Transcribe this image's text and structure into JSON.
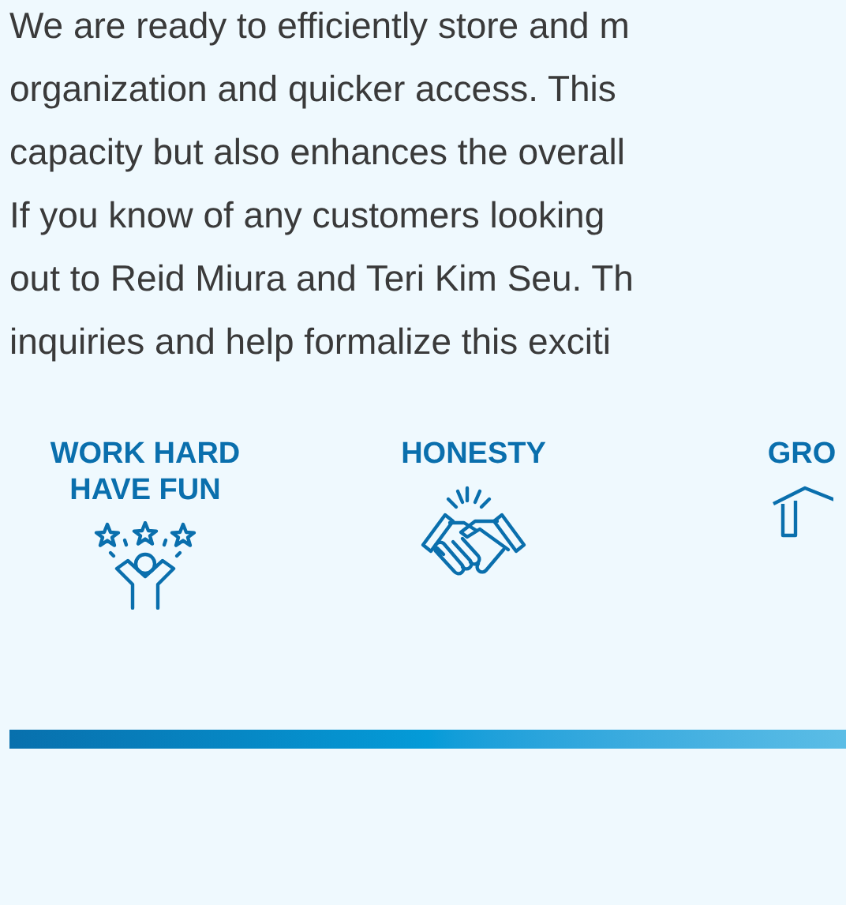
{
  "paragraph_lines": [
    "We are ready to efficiently store and m",
    "organization and quicker access. This",
    "capacity but also enhances the overall",
    "If you know of any customers looking",
    "out to Reid Miura and Teri Kim Seu. Th",
    "inquiries and help formalize this exciti"
  ],
  "values": [
    {
      "title": "WORK HARD\nHAVE FUN",
      "kind": "celebrate"
    },
    {
      "title": "HONESTY",
      "kind": "handshake"
    },
    {
      "title": "GRO",
      "kind": "growth"
    }
  ]
}
